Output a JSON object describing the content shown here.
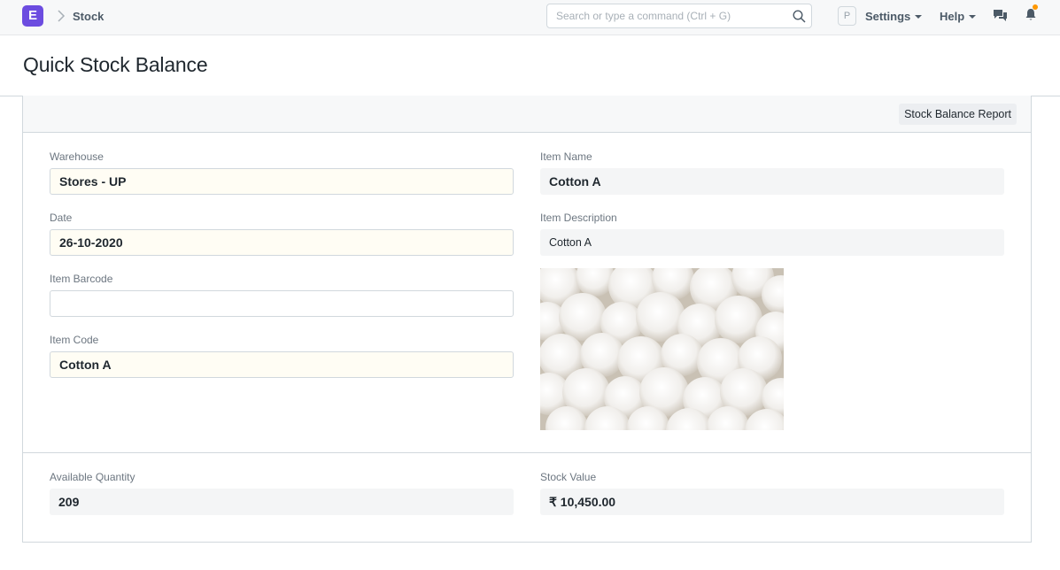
{
  "navbar": {
    "logo_letter": "E",
    "breadcrumb": "Stock",
    "search_placeholder": "Search or type a command (Ctrl + G)",
    "avatar_initial": "P",
    "settings_label": "Settings",
    "help_label": "Help",
    "notification_dot_color": "#ff9800",
    "brand_color": "#6c4ce0"
  },
  "page": {
    "title": "Quick Stock Balance"
  },
  "toolbar": {
    "report_button_label": "Stock Balance Report"
  },
  "form": {
    "warehouse": {
      "label": "Warehouse",
      "value": "Stores - UP"
    },
    "date": {
      "label": "Date",
      "value": "26-10-2020"
    },
    "item_barcode": {
      "label": "Item Barcode",
      "value": ""
    },
    "item_code": {
      "label": "Item Code",
      "value": "Cotton A"
    },
    "item_name": {
      "label": "Item Name",
      "value": "Cotton A"
    },
    "item_description": {
      "label": "Item Description",
      "value": "Cotton A"
    }
  },
  "summary": {
    "available_quantity": {
      "label": "Available Quantity",
      "value": "209"
    },
    "stock_value": {
      "label": "Stock Value",
      "value": "₹ 10,450.00"
    }
  }
}
